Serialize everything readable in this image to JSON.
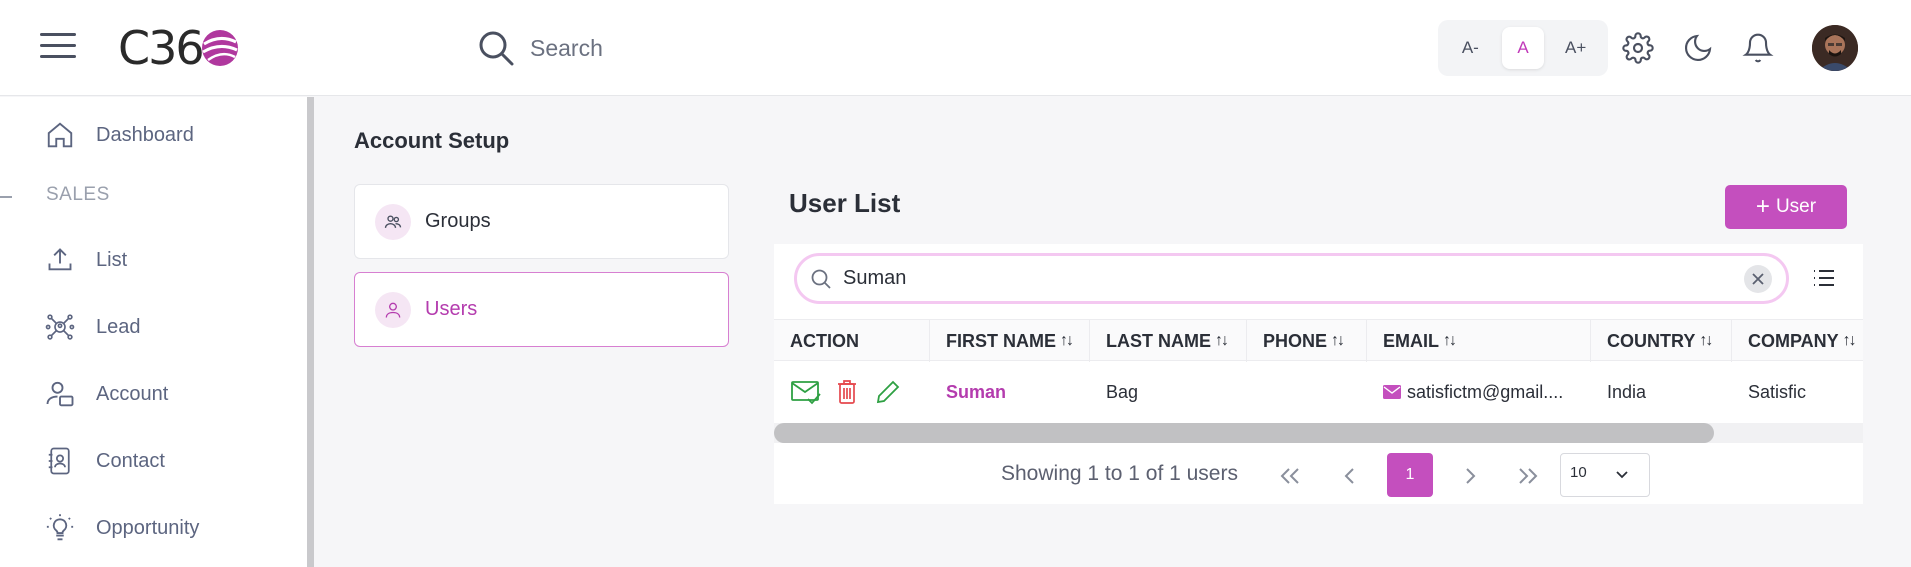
{
  "header": {
    "logo_text": "C36",
    "search_placeholder": "Search",
    "font_sizes": [
      "A-",
      "A",
      "A+"
    ],
    "icons": [
      "menu-icon",
      "search-icon",
      "gear-icon",
      "moon-icon",
      "bell-icon"
    ],
    "accent_color": "#c44fbe"
  },
  "sidebar": {
    "section_label": "SALES",
    "items": [
      {
        "label": "Dashboard",
        "icon": "home-icon"
      },
      {
        "label": "List",
        "icon": "upload-icon"
      },
      {
        "label": "Lead",
        "icon": "network-icon"
      },
      {
        "label": "Account",
        "icon": "user-card-icon"
      },
      {
        "label": "Contact",
        "icon": "contact-book-icon"
      },
      {
        "label": "Opportunity",
        "icon": "lightbulb-icon"
      }
    ]
  },
  "main": {
    "title": "Account Setup",
    "setup_items": [
      {
        "label": "Groups",
        "icon": "group-icon",
        "active": false
      },
      {
        "label": "Users",
        "icon": "user-icon",
        "active": true
      }
    ],
    "user_list": {
      "title": "User List",
      "add_button": "User",
      "filter_value": "Suman",
      "columns": [
        "ACTION",
        "FIRST NAME",
        "LAST NAME",
        "PHONE",
        "EMAIL",
        "COUNTRY",
        "COMPANY"
      ],
      "rows": [
        {
          "first_name": "Suman",
          "last_name": "Bag",
          "phone": "",
          "email": "satisfictm@gmail....",
          "country": "India",
          "company": "Satisfic"
        }
      ],
      "pagination": {
        "summary": "Showing 1 to 1 of 1 users",
        "current_page": "1",
        "page_size": "10"
      }
    }
  }
}
